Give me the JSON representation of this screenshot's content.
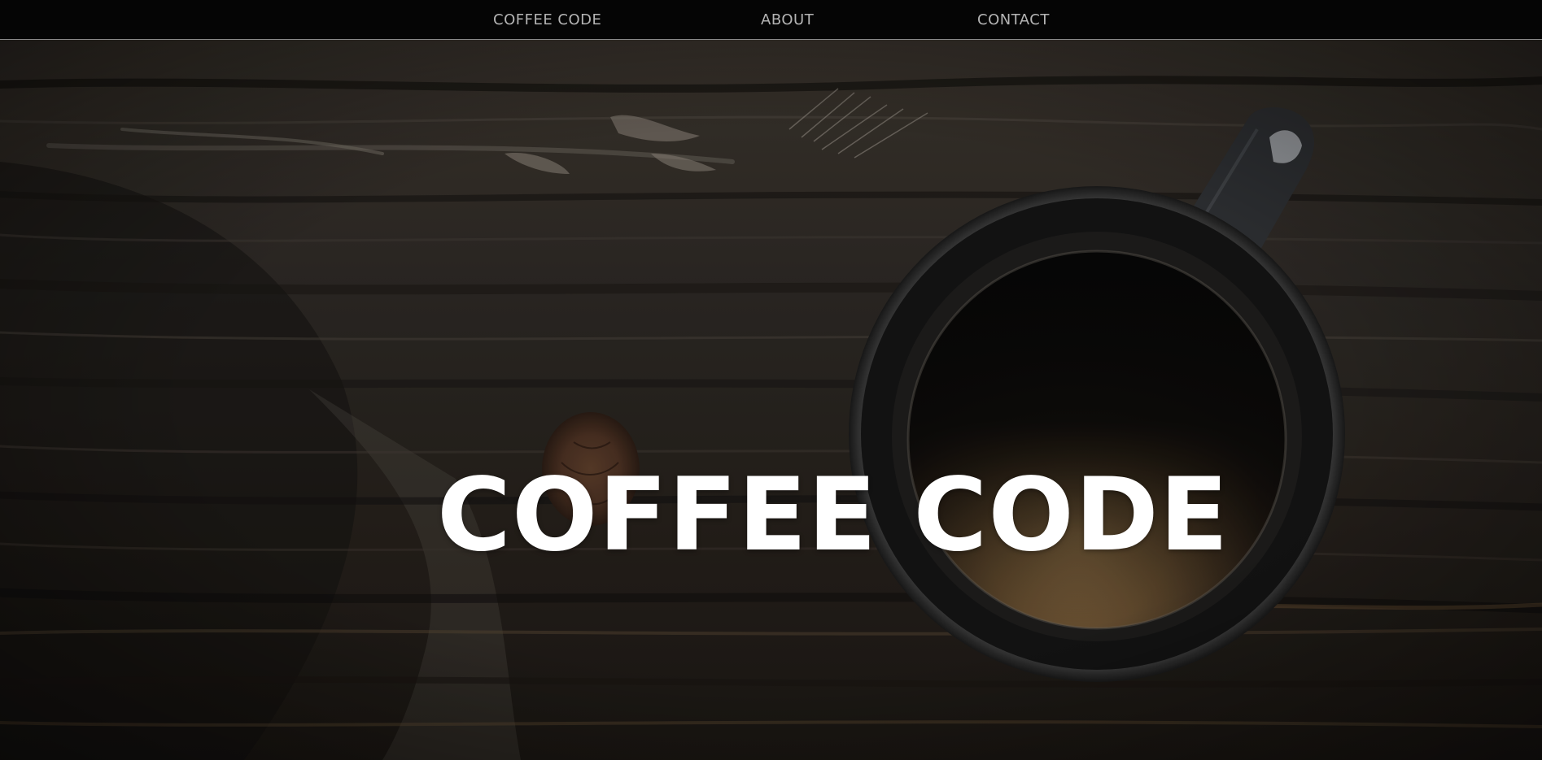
{
  "navbar": {
    "brand": "COFFEE CODE",
    "items": [
      {
        "label": "ABOUT"
      },
      {
        "label": "CONTACT"
      }
    ]
  },
  "hero": {
    "title": "COFFEE CODE",
    "background": "dark wood table with a cup of coffee"
  },
  "colors": {
    "navbar_bg": "#050505",
    "nav_text": "#b4b4b4",
    "hero_title": "#ffffff"
  }
}
